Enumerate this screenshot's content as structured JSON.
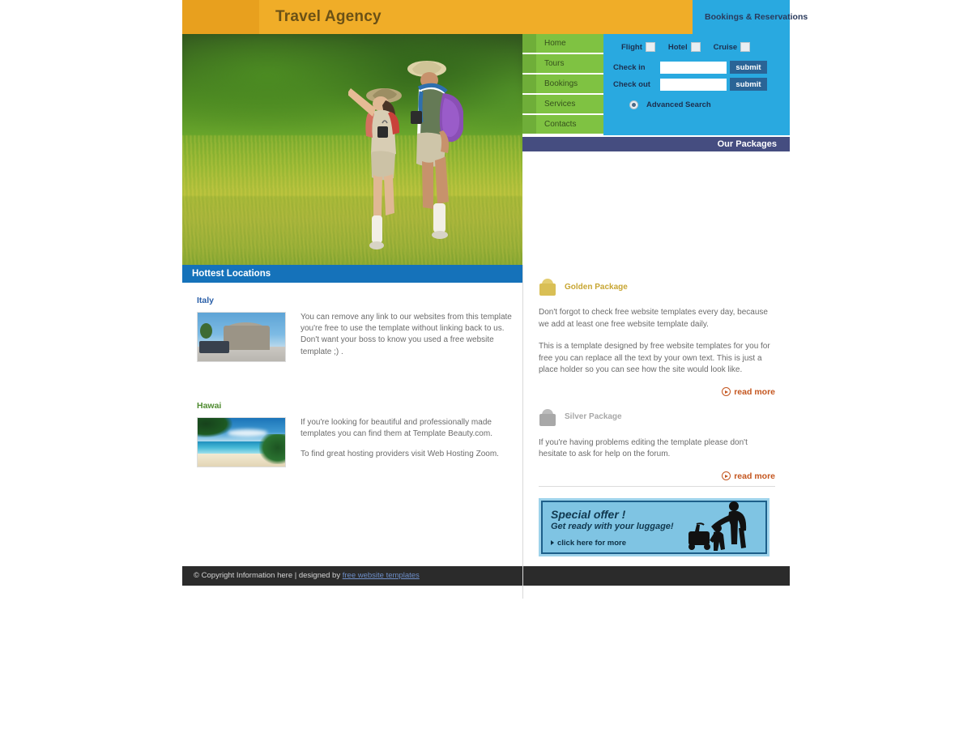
{
  "site": {
    "title": "Travel Agency"
  },
  "nav": {
    "items": [
      {
        "label": "Home"
      },
      {
        "label": "Tours"
      },
      {
        "label": "Bookings"
      },
      {
        "label": "Services"
      },
      {
        "label": "Contacts"
      }
    ]
  },
  "booking": {
    "panel_title": "Bookings & Reservations",
    "checkboxes": [
      {
        "label": "Flight",
        "checked": false
      },
      {
        "label": "Hotel",
        "checked": false
      },
      {
        "label": "Cruise",
        "checked": false
      }
    ],
    "checkin": {
      "label": "Check in",
      "value": "",
      "placeholder": "",
      "submit_label": "submit"
    },
    "checkout": {
      "label": "Check out",
      "value": "",
      "placeholder": "",
      "submit_label": "submit"
    },
    "advanced_search": {
      "label": "Advanced Search",
      "selected": true
    }
  },
  "packages": {
    "bar_title": "Our Packages",
    "golden": {
      "name": "Golden Package",
      "icon": "bag-icon",
      "paragraph1": "Don't forgot to check free website templates every day, because we add at least one free website template daily.",
      "paragraph2": "This is a template designed by free website templates for you for free you can replace all the text by your own text. This is just a place holder so you can see how the site would look like.",
      "read_more": "read more"
    },
    "silver": {
      "name": "Silver Package",
      "icon": "bag-icon",
      "paragraph1": "If you're having problems editing the template please don't hesitate to ask for help on the forum.",
      "read_more": "read more"
    }
  },
  "offer": {
    "headline": "Special offer !",
    "subhead": "Get ready with your luggage!",
    "cta": "click here for more"
  },
  "hottest": {
    "bar_title": "Hottest Locations",
    "locations": [
      {
        "name": "Italy",
        "image_alt": "castel-sant-angelo-photo",
        "paragraphs": [
          "You can remove any link to our websites from this template you're free to use the template without linking back to us. Don't want your boss to know you used a free website template ;) ."
        ]
      },
      {
        "name": "Hawai",
        "image_alt": "tropical-beach-photo",
        "paragraphs": [
          "If you're looking for beautiful and professionally made templates you can find them at Template Beauty.com.",
          "To find great hosting providers visit Web Hosting Zoom."
        ]
      }
    ]
  },
  "hero": {
    "image_alt": "two-hikers-in-grassland-photo"
  },
  "footer": {
    "text": "© Copyright Information here | designed by ",
    "link": "free website templates"
  },
  "colors": {
    "header_orange": "#f0ad28",
    "header_orange_dark": "#e8a01e",
    "nav_green": "#7fc242",
    "nav_green_dark": "#6fae39",
    "booking_blue": "#29a9e0",
    "packages_bar": "#454d80",
    "hot_bar_blue": "#1572ba",
    "read_more": "#c4561f",
    "footer_bg": "#2b2b2b",
    "footer_link": "#6e8fc9"
  }
}
